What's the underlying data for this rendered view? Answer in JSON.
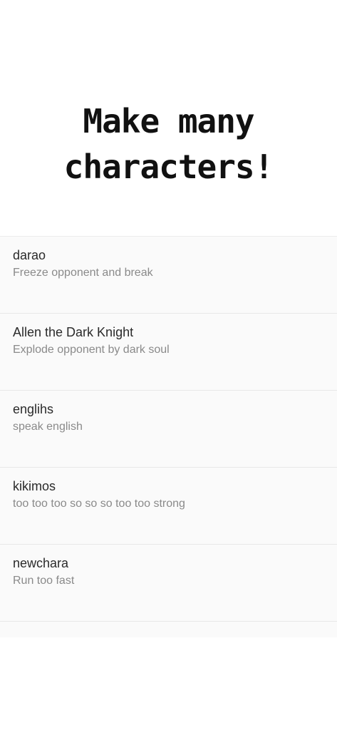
{
  "promo": {
    "line1": "Make many",
    "line2": "characters!"
  },
  "characters": [
    {
      "name": "darao",
      "description": "Freeze opponent and break"
    },
    {
      "name": "Allen the Dark Knight",
      "description": "Explode opponent by dark soul"
    },
    {
      "name": "englihs",
      "description": "speak english"
    },
    {
      "name": "kikimos",
      "description": "too too too so so so too too strong"
    },
    {
      "name": "newchara",
      "description": "Run too fast"
    },
    {
      "name": "-----",
      "description": ""
    }
  ]
}
